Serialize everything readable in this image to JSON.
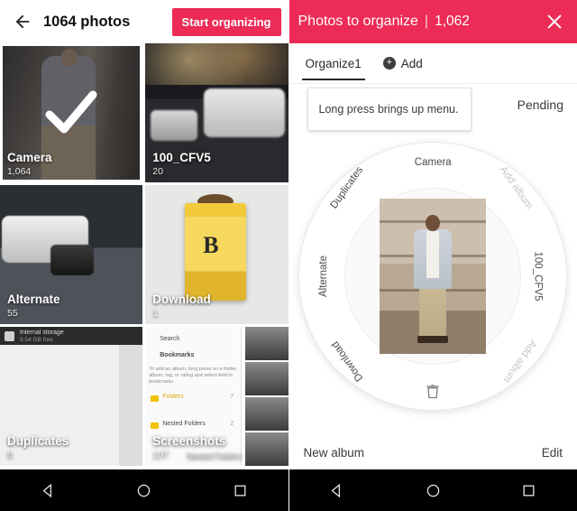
{
  "left_screen": {
    "appbar": {
      "back_icon": "back-arrow-icon",
      "title": "1064 photos",
      "start_button": "Start organizing"
    },
    "albums": [
      {
        "label": "Camera",
        "count": "1,064",
        "selected": true
      },
      {
        "label": "100_CFV5",
        "count": "20",
        "selected": false
      },
      {
        "label": "Alternate",
        "count": "55",
        "selected": false
      },
      {
        "label": "Download",
        "count": "1",
        "selected": false
      },
      {
        "label": "Duplicates",
        "count": "8",
        "selected": false
      },
      {
        "label": "Screenshots",
        "count": "107",
        "extra": "Albums",
        "selected": false
      }
    ],
    "thumb_overlays": {
      "storage_title": "Internal storage",
      "storage_sub": "9.54 GB free",
      "search": "Search",
      "bookmarks": "Bookmarks",
      "bookmarks_hint": "To add an album, long press on a folder, album, tag, or rating and select Add to bookmarks",
      "folders": "Folders",
      "folders_count": "7",
      "nested": "Nested Folders",
      "nested_count": "2"
    }
  },
  "right_screen": {
    "appbar": {
      "title": "Photos to organize",
      "divider": "|",
      "count": "1,062",
      "close_icon": "close-icon"
    },
    "tabs": {
      "active_tab": "Organize1",
      "add_label": "Add",
      "add_icon": "plus-circle-icon"
    },
    "hint": "Long press brings up menu.",
    "pending": "Pending",
    "wheel": {
      "labels": [
        {
          "text": "Camera",
          "muted": false
        },
        {
          "text": "Add album",
          "muted": true
        },
        {
          "text": "100_CFV5",
          "muted": false
        },
        {
          "text": "Add album",
          "muted": true
        },
        {
          "text": "Download",
          "muted": false
        },
        {
          "text": "Alternate",
          "muted": false
        },
        {
          "text": "Duplicates",
          "muted": false
        }
      ],
      "trash_icon": "trash-icon"
    },
    "footer": {
      "new_album": "New album",
      "edit": "Edit"
    }
  },
  "navbar": {
    "back_icon": "triangle-back-icon",
    "home_icon": "circle-home-icon",
    "recents_icon": "square-recents-icon"
  },
  "colors": {
    "accent": "#ec2b56",
    "appbar_text": "#ffffff",
    "nav_background": "#000000"
  }
}
